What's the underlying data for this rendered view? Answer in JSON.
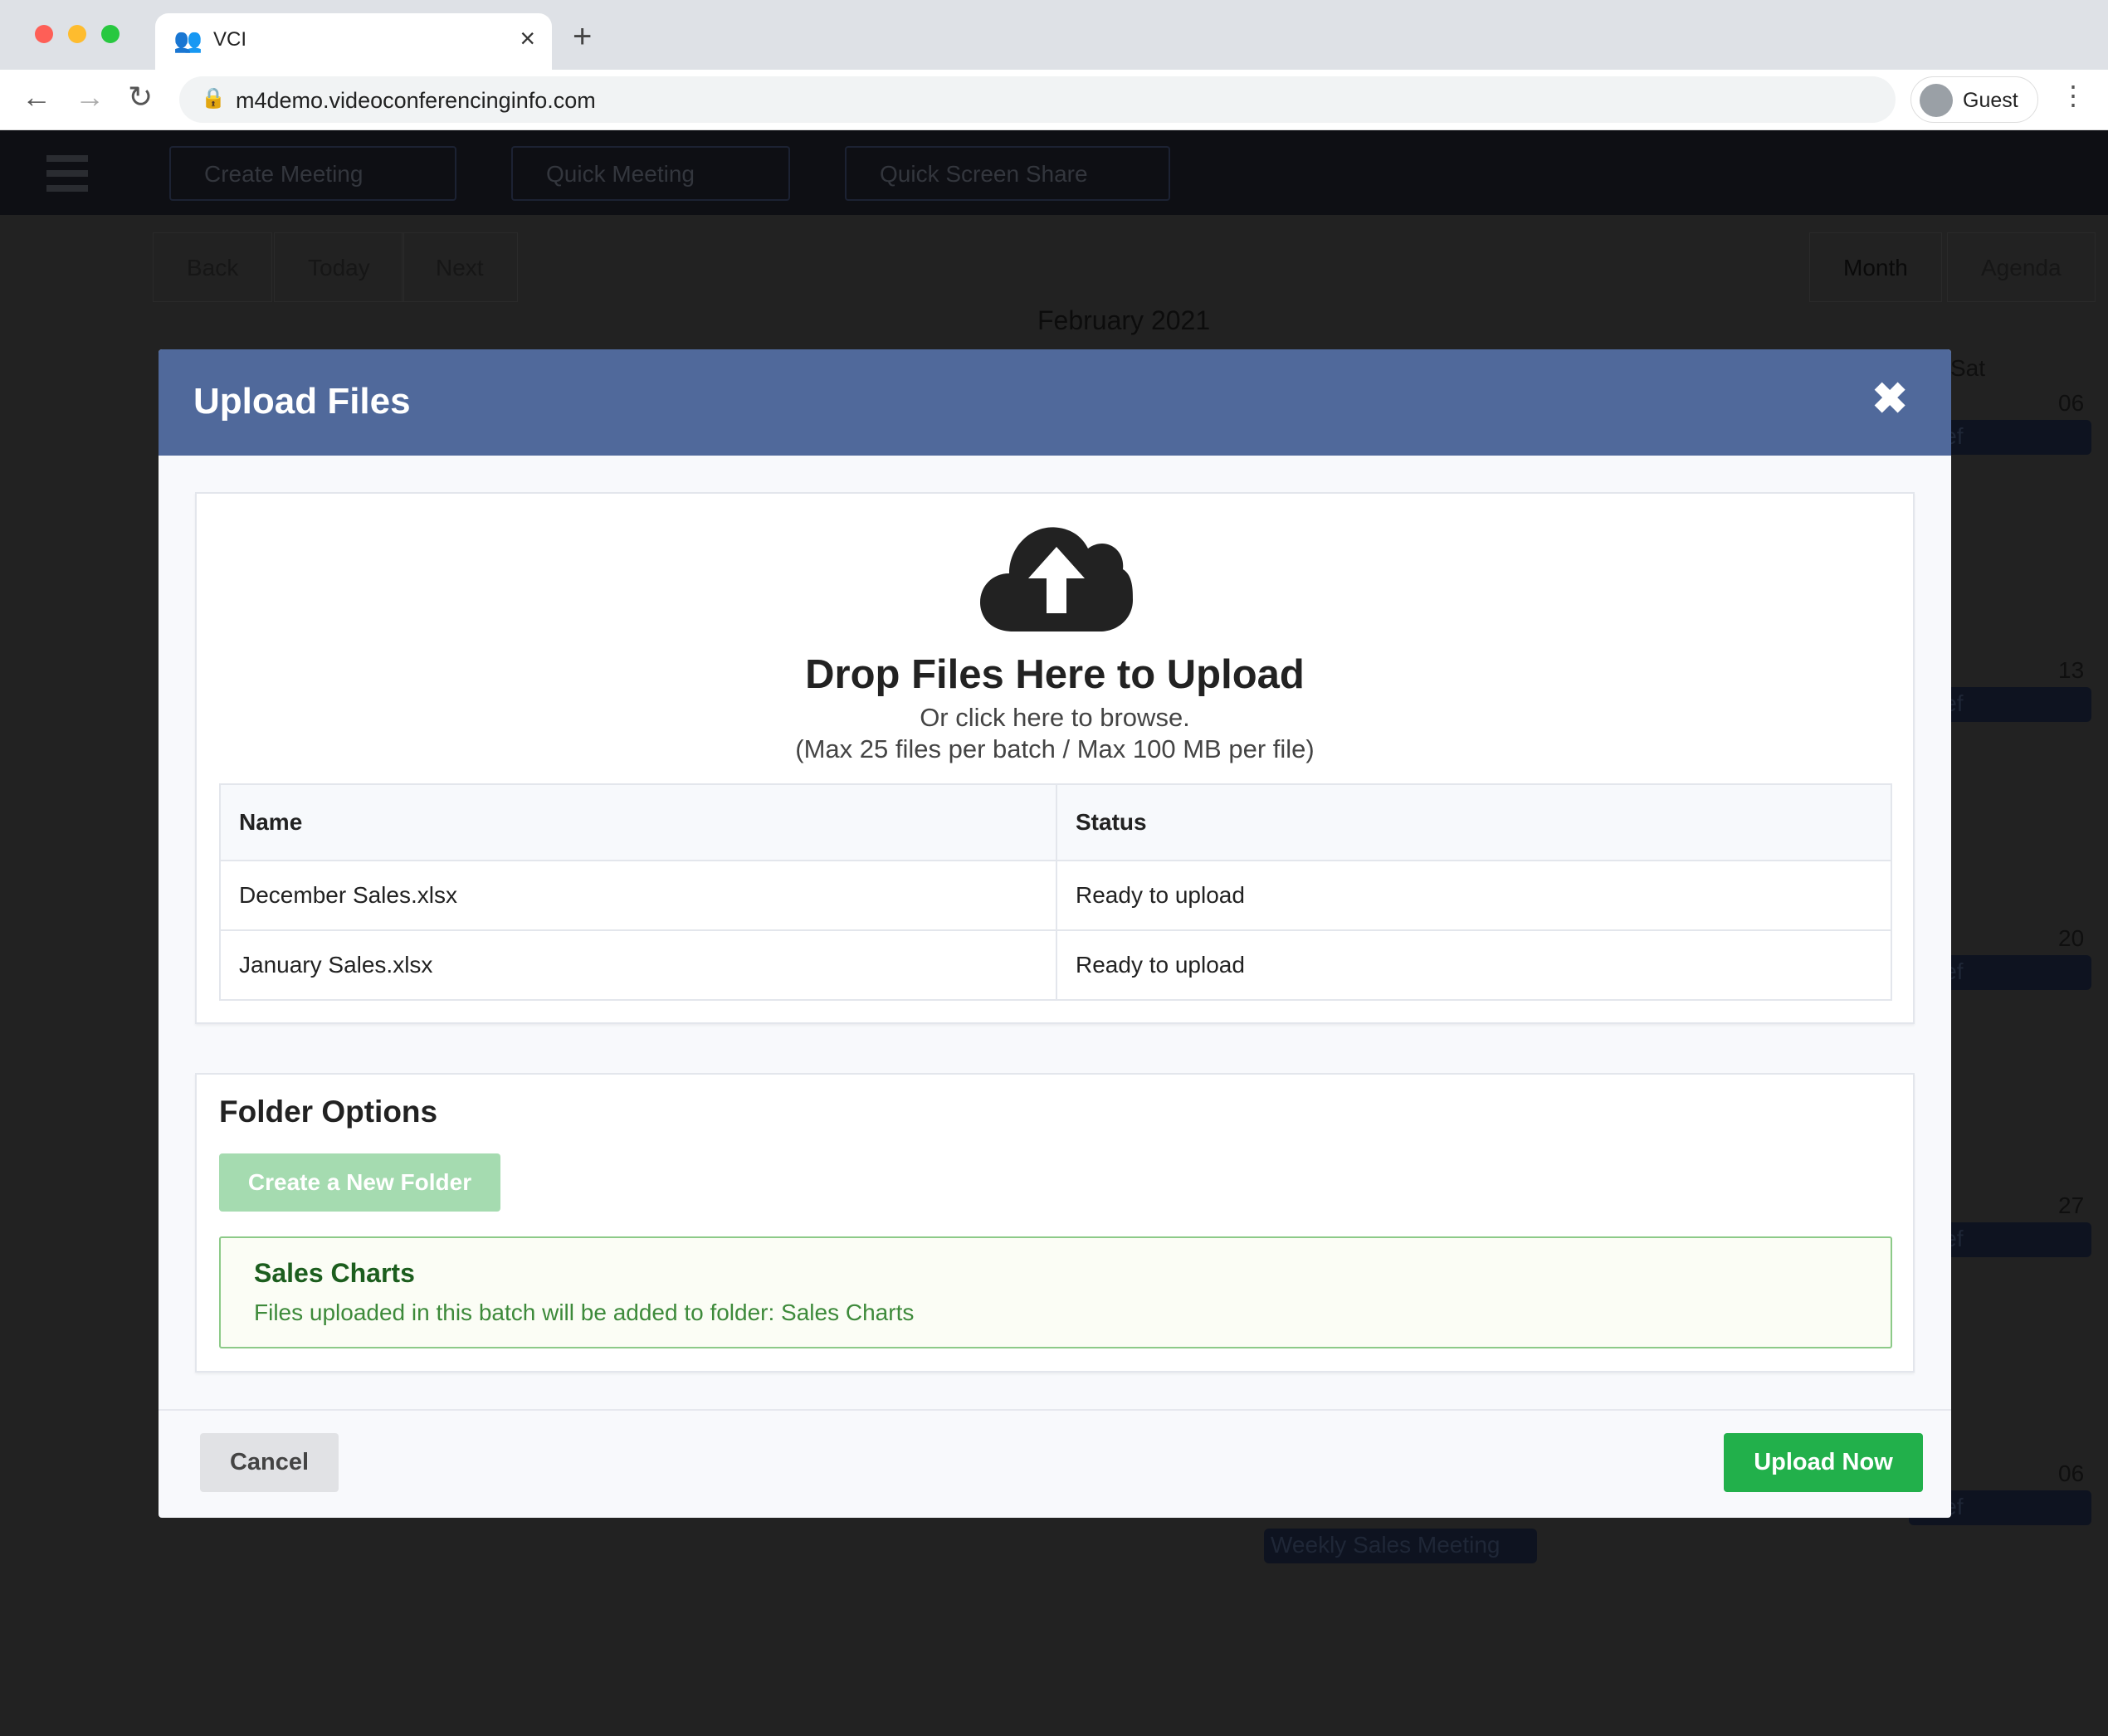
{
  "browser": {
    "tab_title": "VCI",
    "url": "m4demo.videoconferencinginfo.com",
    "profile": "Guest"
  },
  "app": {
    "header_buttons": [
      "Create Meeting",
      "Quick Meeting",
      "Quick Screen Share"
    ],
    "calendar": {
      "nav": [
        "Back",
        "Today",
        "Next"
      ],
      "views": [
        "Month",
        "Agenda"
      ],
      "title": "February 2021",
      "day_label": "Sat",
      "day_numbers": [
        "06",
        "13",
        "20",
        "27",
        "06"
      ],
      "event_brief": "Brief",
      "event": "Weekly Sales Meeting"
    }
  },
  "modal": {
    "title": "Upload Files",
    "dropzone": {
      "title": "Drop Files Here to Upload",
      "subtitle": "Or click here to browse.",
      "limits": "(Max 25 files per batch / Max 100 MB per file)"
    },
    "table": {
      "headers": [
        "Name",
        "Status"
      ],
      "rows": [
        [
          "December Sales.xlsx",
          "Ready to upload"
        ],
        [
          "January Sales.xlsx",
          "Ready to upload"
        ]
      ]
    },
    "folder": {
      "title": "Folder Options",
      "new_folder_button": "Create a New Folder",
      "selected_name": "Sales Charts",
      "selected_message": "Files uploaded in this batch will be added to folder: Sales Charts"
    },
    "cancel": "Cancel",
    "upload": "Upload Now"
  },
  "colors": {
    "modal_header": "#50699b",
    "primary": "#22b04b"
  }
}
